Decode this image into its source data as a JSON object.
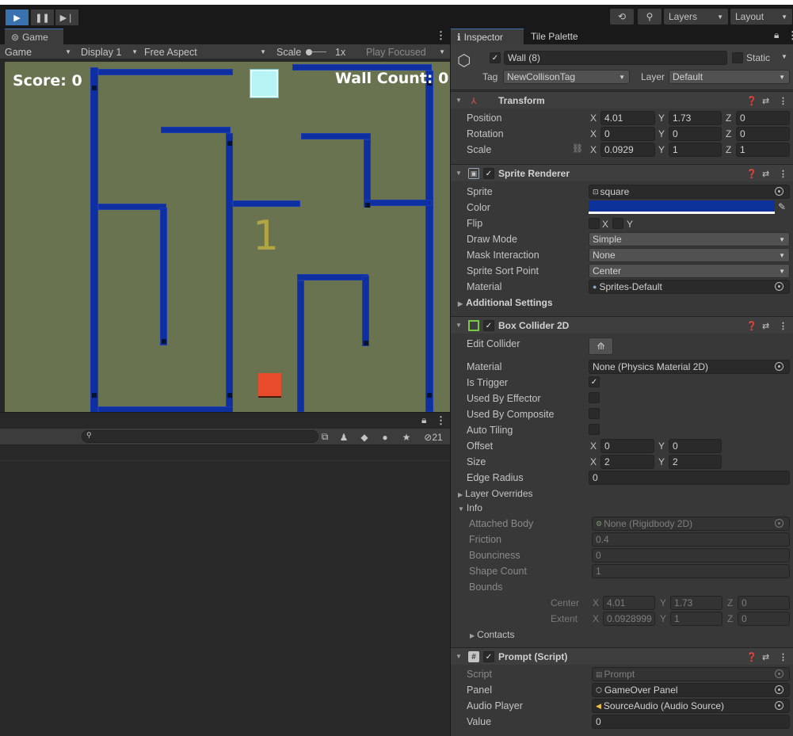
{
  "toolbar": {
    "layers_label": "Layers",
    "layout_label": "Layout"
  },
  "game_panel": {
    "tab_label": "Game",
    "display_mode": "Game",
    "display": "Display 1",
    "aspect": "Free Aspect",
    "scale_label": "Scale",
    "scale_value": "1x",
    "play_focused": "Play Focused"
  },
  "game_view": {
    "score_text": "Score: 0",
    "wall_count_text": "Wall Count: 0",
    "center_number": "1",
    "colors": {
      "background": "#6a7350",
      "wall": "#0d2fa0",
      "goal": "#b7f3f5",
      "player": "#e84c2b"
    }
  },
  "bottom_panel": {
    "hidden_count": "21"
  },
  "inspector": {
    "tab_inspector": "Inspector",
    "tab_tile_palette": "Tile Palette",
    "object_name": "Wall (8)",
    "static_label": "Static",
    "tag_label": "Tag",
    "tag_value": "NewCollisonTag",
    "layer_label": "Layer",
    "layer_value": "Default",
    "transform": {
      "title": "Transform",
      "position_label": "Position",
      "rotation_label": "Rotation",
      "scale_label": "Scale",
      "position": {
        "x": "4.01",
        "y": "1.73",
        "z": "0"
      },
      "rotation": {
        "x": "0",
        "y": "0",
        "z": "0"
      },
      "scale": {
        "x": "0.0929",
        "y": "1",
        "z": "1"
      }
    },
    "sprite_renderer": {
      "title": "Sprite Renderer",
      "sprite_label": "Sprite",
      "sprite_value": "square",
      "color_label": "Color",
      "color_value": "#0d3299",
      "flip_label": "Flip",
      "flip_x": "X",
      "flip_y": "Y",
      "draw_mode_label": "Draw Mode",
      "draw_mode_value": "Simple",
      "mask_label": "Mask Interaction",
      "mask_value": "None",
      "sort_label": "Sprite Sort Point",
      "sort_value": "Center",
      "material_label": "Material",
      "material_value": "Sprites-Default",
      "additional": "Additional Settings"
    },
    "box_collider": {
      "title": "Box Collider 2D",
      "edit_label": "Edit Collider",
      "material_label": "Material",
      "material_value": "None (Physics Material 2D)",
      "is_trigger_label": "Is Trigger",
      "effector_label": "Used By Effector",
      "composite_label": "Used By Composite",
      "autotiling_label": "Auto Tiling",
      "offset_label": "Offset",
      "offset": {
        "x": "0",
        "y": "0"
      },
      "size_label": "Size",
      "size": {
        "x": "2",
        "y": "2"
      },
      "edge_label": "Edge Radius",
      "edge_value": "0",
      "layer_overrides": "Layer Overrides",
      "info": "Info",
      "attached_label": "Attached Body",
      "attached_value": "None (Rigidbody 2D)",
      "friction_label": "Friction",
      "friction_value": "0.4",
      "bounciness_label": "Bounciness",
      "bounciness_value": "0",
      "shape_label": "Shape Count",
      "shape_value": "1",
      "bounds_label": "Bounds",
      "center_label": "Center",
      "center": {
        "x": "4.01",
        "y": "1.73",
        "z": "0"
      },
      "extent_label": "Extent",
      "extent": {
        "x": "0.0928999",
        "y": "1",
        "z": "0"
      },
      "contacts": "Contacts"
    },
    "prompt_script": {
      "title": "Prompt (Script)",
      "script_label": "Script",
      "script_value": "Prompt",
      "panel_label": "Panel",
      "panel_value": "GameOver Panel",
      "audio_label": "Audio Player",
      "audio_value": "SourceAudio (Audio Source)",
      "value_label": "Value",
      "value_value": "0"
    }
  }
}
